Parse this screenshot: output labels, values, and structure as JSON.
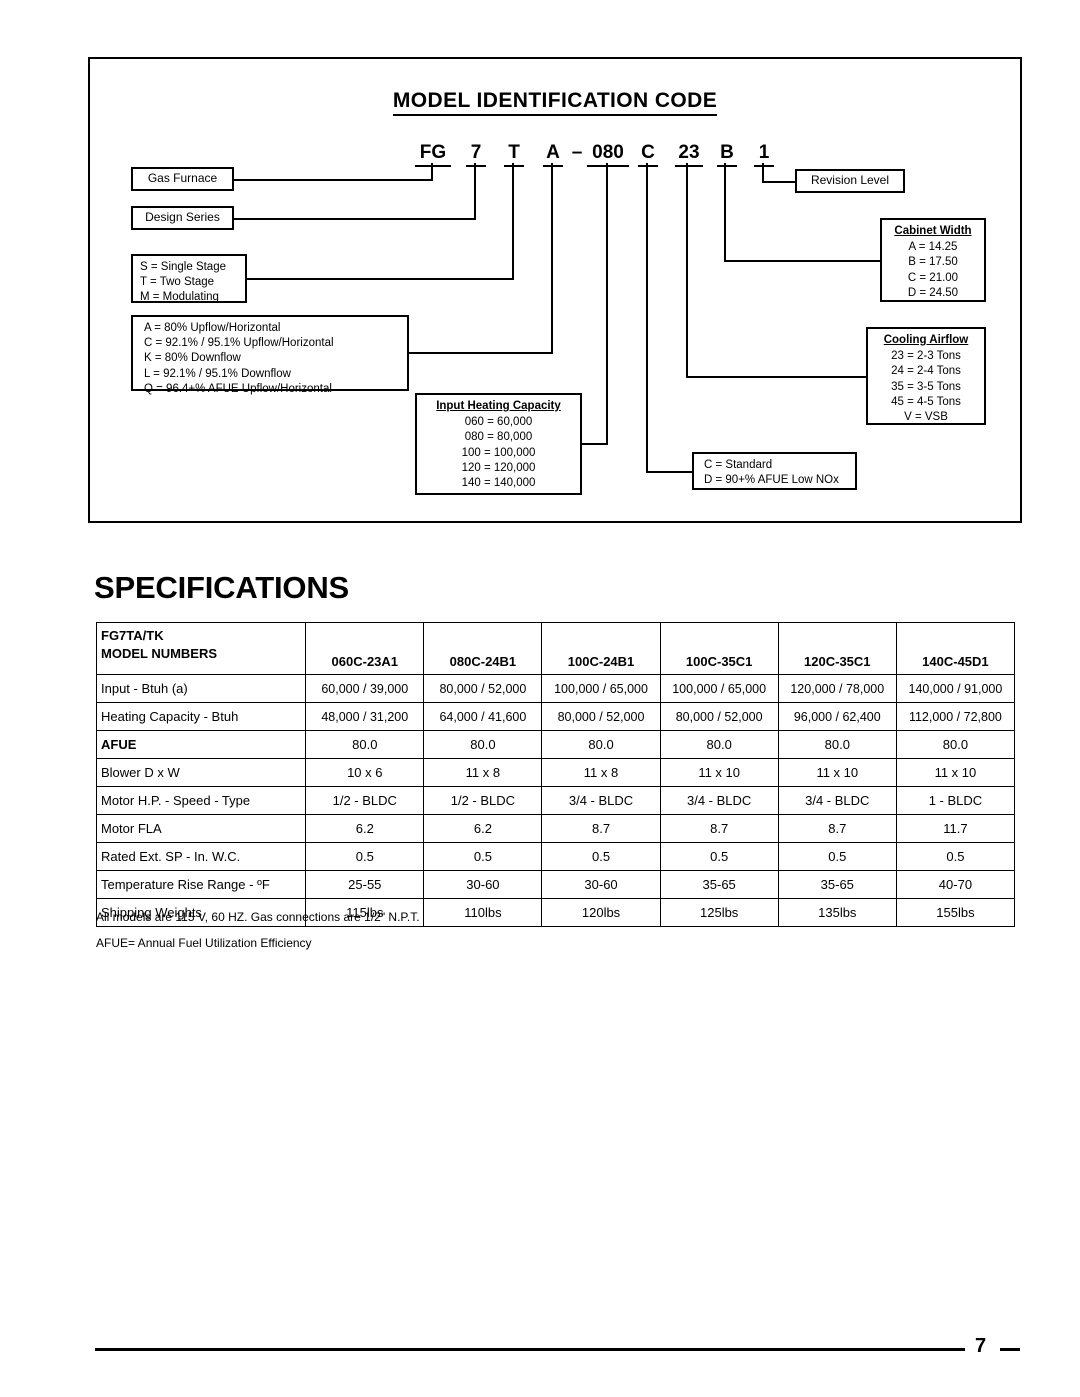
{
  "model_identification": {
    "title": "MODEL IDENTIFICATION CODE",
    "code_segments": [
      {
        "id": "seg-fg",
        "text": "FG"
      },
      {
        "id": "seg-7",
        "text": "7"
      },
      {
        "id": "seg-t",
        "text": "T"
      },
      {
        "id": "seg-a",
        "text": "A"
      },
      {
        "id": "seg-080",
        "text": "080"
      },
      {
        "id": "seg-c",
        "text": "C"
      },
      {
        "id": "seg-23",
        "text": "23"
      },
      {
        "id": "seg-b",
        "text": "B"
      },
      {
        "id": "seg-1",
        "text": "1"
      }
    ],
    "code_dash": "–",
    "boxes": {
      "gas_furnace": {
        "label": "Gas Furnace"
      },
      "design_series": {
        "label": "Design Series"
      },
      "revision_level": {
        "label": "Revision Level"
      },
      "stage": {
        "lines": [
          "S = Single Stage",
          "T = Two Stage",
          "M = Modulating"
        ]
      },
      "configuration": {
        "lines": [
          "A = 80% Upflow/Horizontal",
          "C = 92.1% / 95.1% Upflow/Horizontal",
          "K = 80% Downflow",
          "L = 92.1% / 95.1% Downflow",
          "Q = 96.4+% AFUE Upflow/Horizontal"
        ]
      },
      "input_heating_capacity": {
        "title": "Input Heating Capacity",
        "lines": [
          "060 = 60,000",
          "080 = 80,000",
          "100 = 100,000",
          "120 = 120,000",
          "140 = 140,000"
        ]
      },
      "nox": {
        "lines": [
          "C = Standard",
          "D = 90+% AFUE Low NOx"
        ]
      },
      "cabinet_width": {
        "title": "Cabinet Width",
        "lines": [
          "A = 14.25",
          "B = 17.50",
          "C = 21.00",
          "D = 24.50"
        ]
      },
      "cooling_airflow": {
        "title": "Cooling Airflow",
        "lines": [
          "23 = 2-3 Tons",
          "24 = 2-4 Tons",
          "35 = 3-5 Tons",
          "45 = 4-5 Tons",
          "V = VSB"
        ]
      }
    }
  },
  "specifications": {
    "title": "SPECIFICATIONS",
    "table": {
      "corner_line1": "FG7TA/TK",
      "corner_line2": "MODEL NUMBERS",
      "columns": [
        "060C-23A1",
        "080C-24B1",
        "100C-24B1",
        "100C-35C1",
        "120C-35C1",
        "140C-45D1"
      ],
      "rows": [
        {
          "label": "Input - Btuh (a)",
          "bold": false,
          "values": [
            "60,000 / 39,000",
            "80,000 / 52,000",
            "100,000 / 65,000",
            "100,000 / 65,000",
            "120,000 / 78,000",
            "140,000 / 91,000"
          ]
        },
        {
          "label": "Heating Capacity - Btuh",
          "bold": false,
          "values": [
            "48,000 / 31,200",
            "64,000 / 41,600",
            "80,000 / 52,000",
            "80,000 / 52,000",
            "96,000 / 62,400",
            "112,000 / 72,800"
          ]
        },
        {
          "label": "AFUE",
          "bold": true,
          "values": [
            "80.0",
            "80.0",
            "80.0",
            "80.0",
            "80.0",
            "80.0"
          ]
        },
        {
          "label": "Blower D x W",
          "bold": false,
          "values": [
            "10 x 6",
            "11 x 8",
            "11 x  8",
            "11 x 10",
            "11 x 10",
            "11 x 10"
          ]
        },
        {
          "label": "Motor H.P. - Speed - Type",
          "bold": false,
          "values": [
            "1/2 - BLDC",
            "1/2 - BLDC",
            "3/4 - BLDC",
            "3/4 - BLDC",
            "3/4 - BLDC",
            "1 - BLDC"
          ]
        },
        {
          "label": "Motor FLA",
          "bold": false,
          "values": [
            "6.2",
            "6.2",
            "8.7",
            "8.7",
            "8.7",
            "11.7"
          ]
        },
        {
          "label": "Rated Ext. SP - In. W.C.",
          "bold": false,
          "values": [
            "0.5",
            "0.5",
            "0.5",
            "0.5",
            "0.5",
            "0.5"
          ]
        },
        {
          "label": "Temperature Rise Range - ºF",
          "bold": false,
          "values": [
            "25-55",
            "30-60",
            "30-60",
            "35-65",
            "35-65",
            "40-70"
          ]
        },
        {
          "label": "Shipping Weights",
          "bold": false,
          "values": [
            "115lbs",
            "110lbs",
            "120lbs",
            "125lbs",
            "135lbs",
            "155lbs"
          ]
        }
      ]
    },
    "notes": [
      "All models are 115 V, 60 HZ. Gas connections are 1/2\" N.P.T.",
      "AFUE= Annual Fuel Utilization Efficiency"
    ]
  },
  "footer": {
    "page_number": "7"
  }
}
